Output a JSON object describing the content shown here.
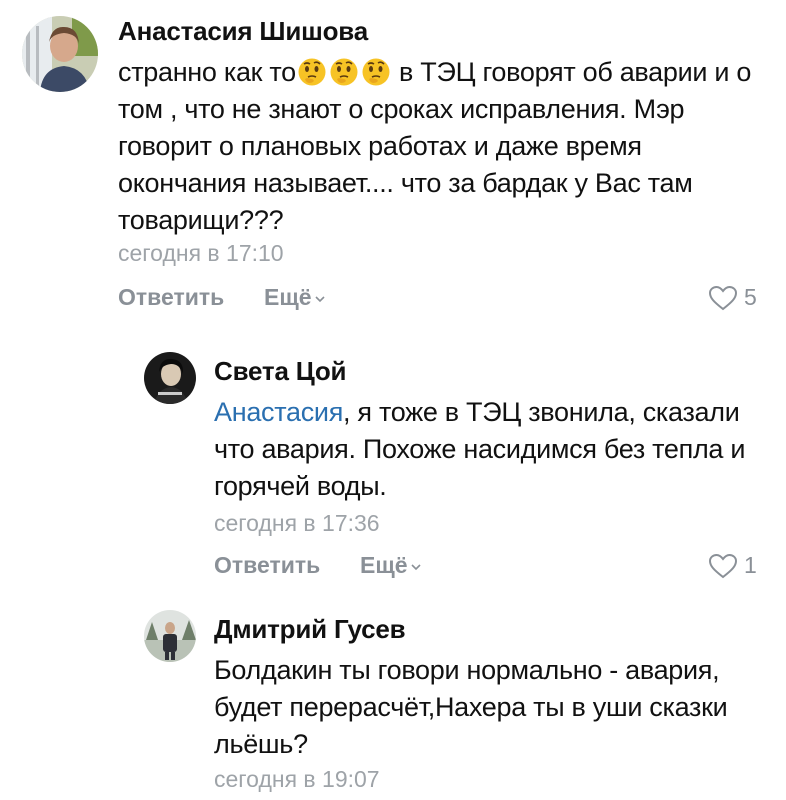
{
  "comments": [
    {
      "author": "Анастасия Шишова",
      "text_line1_pre": "странно как то",
      "text_line1_post": " в ТЭЦ говорят об аварии",
      "emojis": [
        "thinking-face",
        "thinking-face",
        "thinking-face"
      ],
      "text_rest": "и о том , что не знают о сроках исправления. Мэр говорит о плановых работах и даже время окончания называет.... что за бардак у Вас там товарищи???",
      "time": "сегодня в 17:10",
      "reply_label": "Ответить",
      "more_label": "Ещё",
      "likes": "5"
    },
    {
      "author": "Света Цой",
      "mention": "Анастасия",
      "text": ", я тоже в ТЭЦ звонила, сказали что авария. Похоже насидимся без тепла и горячей воды.",
      "time": "сегодня в 17:36",
      "reply_label": "Ответить",
      "more_label": "Ещё",
      "likes": "1"
    },
    {
      "author": "Дмитрий Гусев",
      "text": "Болдакин ты говори нормально - авария, будет перерасчёт,Нахера ты в уши сказки льёшь?",
      "time": "сегодня в 19:07"
    }
  ],
  "colors": {
    "mention": "#2a6fb0",
    "secondary": "#8a9097",
    "timestamp": "#9ea3a8"
  }
}
